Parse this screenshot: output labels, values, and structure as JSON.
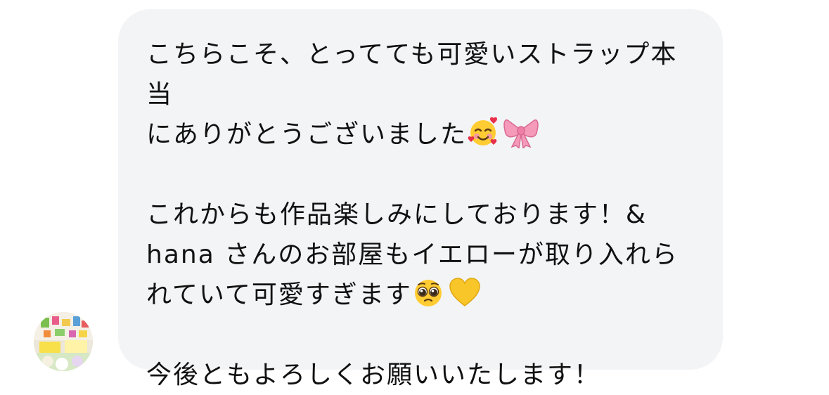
{
  "message": {
    "paragraph1": {
      "line1": "こちらこそ、とってても可愛いストラップ本当",
      "line2": "にありがとうございました"
    },
    "paragraph2": {
      "line1": "これからも作品楽しみにしております！&",
      "line2": "hana さんのお部屋もイエローが取り入れら",
      "line3": "れていて可愛すぎます"
    },
    "paragraph3": {
      "line1": "今後ともよろしくお願いいたします！"
    }
  },
  "emojis": {
    "e1": "smiling-face-with-hearts-icon",
    "e2": "pink-ribbon-icon",
    "e3": "pleading-face-icon",
    "e4": "yellow-heart-icon"
  },
  "colors": {
    "bubble_background": "#f3f4f6",
    "text": "#111111"
  }
}
